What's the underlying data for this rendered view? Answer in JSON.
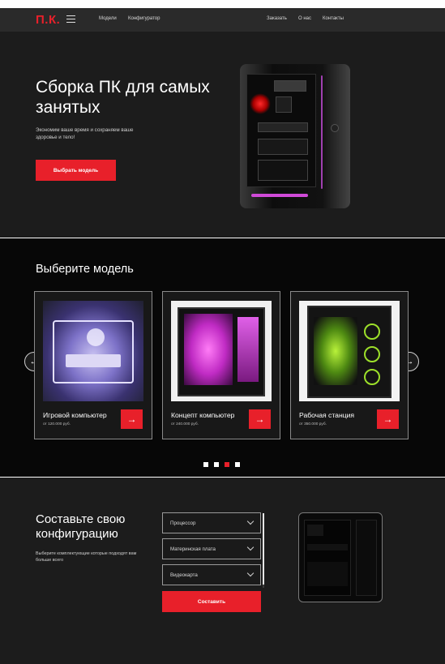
{
  "nav": {
    "logo": "П.К.",
    "links": [
      "Модели",
      "Конфигуратор"
    ],
    "right_links": [
      "Заказать",
      "О нас",
      "Контакты"
    ]
  },
  "hero": {
    "title": "Сборка ПК для самых занятых",
    "subtitle": "Экономим ваше время и сохраняем ваше здоровье и тело!",
    "button": "Выбрать модель"
  },
  "models": {
    "title": "Выберите модель",
    "prev_icon": "←",
    "next_icon": "→",
    "cards": [
      {
        "name": "Игровой компьютер",
        "price": "от 120.000 руб.",
        "arrow": "→"
      },
      {
        "name": "Концепт компьютер",
        "price": "от 240.000 руб.",
        "arrow": "→"
      },
      {
        "name": "Рабочая станция",
        "price": "от 350.000 руб.",
        "arrow": "→"
      }
    ],
    "active_dot": 2,
    "dot_count": 4
  },
  "config": {
    "title": "Составьте свою конфигурацию",
    "subtitle": "Выберите комплектующие которые подходят вам больше всего",
    "selects": [
      "Процессор",
      "Материнская плата",
      "Видеокарта"
    ],
    "button": "Составить"
  },
  "colors": {
    "accent": "#e8202a",
    "nav_bg": "#2a2a2a",
    "hero_bg": "#1c1c1c",
    "models_bg": "#070707"
  }
}
